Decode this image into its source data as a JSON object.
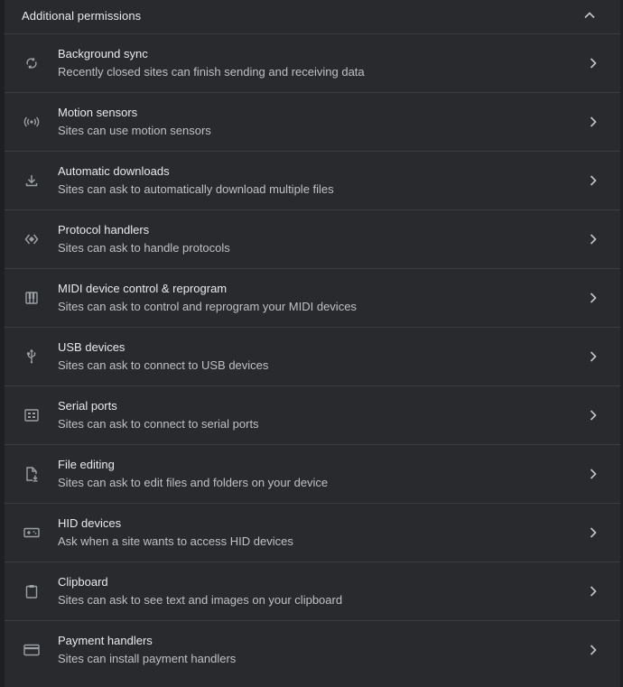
{
  "section": {
    "title": "Additional permissions",
    "collapse_icon": "chevron-up-icon"
  },
  "colors": {
    "background": "#292a2d",
    "text_primary": "#e8eaed",
    "text_secondary": "#bdc1c6",
    "icon": "#9aa0a6",
    "divider": "#3c3d40"
  },
  "items": [
    {
      "label": "Background sync",
      "description": "Recently closed sites can finish sending and receiving data",
      "icon": "sync-icon"
    },
    {
      "label": "Motion sensors",
      "description": "Sites can use motion sensors",
      "icon": "sensors-icon"
    },
    {
      "label": "Automatic downloads",
      "description": "Sites can ask to automatically download multiple files",
      "icon": "download-icon"
    },
    {
      "label": "Protocol handlers",
      "description": "Sites can ask to handle protocols",
      "icon": "protocol-handler-icon"
    },
    {
      "label": "MIDI device control & reprogram",
      "description": "Sites can ask to control and reprogram your MIDI devices",
      "icon": "midi-piano-icon"
    },
    {
      "label": "USB devices",
      "description": "Sites can ask to connect to USB devices",
      "icon": "usb-icon"
    },
    {
      "label": "Serial ports",
      "description": "Sites can ask to connect to serial ports",
      "icon": "serial-port-icon"
    },
    {
      "label": "File editing",
      "description": "Sites can ask to edit files and folders on your device",
      "icon": "file-edit-icon"
    },
    {
      "label": "HID devices",
      "description": "Ask when a site wants to access HID devices",
      "icon": "gamepad-icon"
    },
    {
      "label": "Clipboard",
      "description": "Sites can ask to see text and images on your clipboard",
      "icon": "clipboard-icon"
    },
    {
      "label": "Payment handlers",
      "description": "Sites can install payment handlers",
      "icon": "payment-card-icon"
    }
  ]
}
